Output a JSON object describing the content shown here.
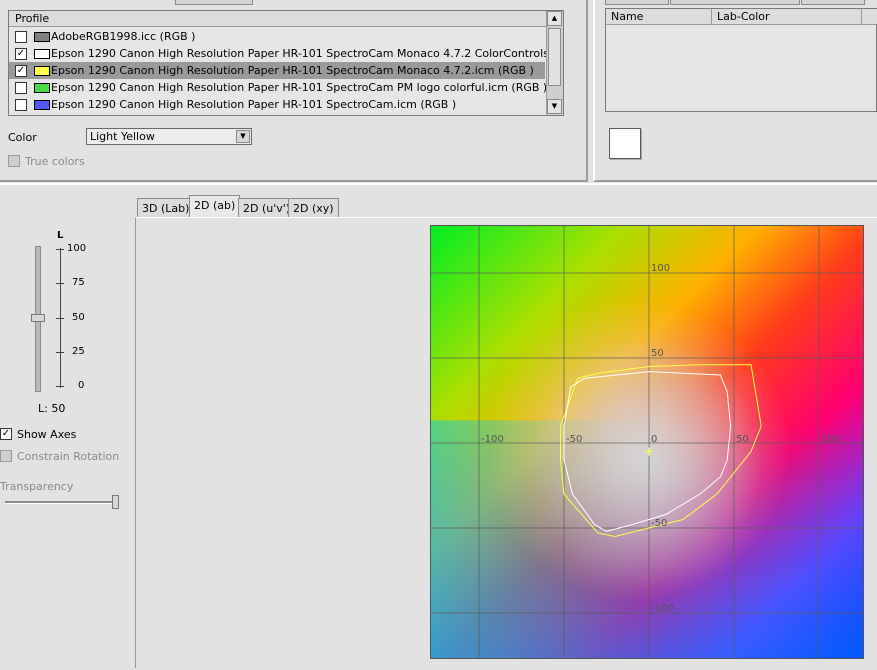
{
  "profiles_list": {
    "header": "Profile",
    "rows": [
      {
        "checked": false,
        "swatch": "#808080",
        "text": "AdobeRGB1998.icc (RGB )",
        "selected": false
      },
      {
        "checked": true,
        "swatch": "#ffffff",
        "text": "Epson 1290 Canon High Resolution Paper HR-101 SpectroCam Monaco 4.7.2 ColorControls.icm (RGB )",
        "selected": false
      },
      {
        "checked": true,
        "swatch": "#ffff44",
        "text": "Epson 1290 Canon High Resolution Paper HR-101 SpectroCam Monaco 4.7.2.icm (RGB )",
        "selected": true
      },
      {
        "checked": false,
        "swatch": "#44dd44",
        "text": "Epson 1290 Canon High Resolution Paper HR-101 SpectroCam PM logo colorful.icm (RGB )",
        "selected": false
      },
      {
        "checked": false,
        "swatch": "#5555ff",
        "text": "Epson 1290 Canon High Resolution Paper HR-101 SpectroCam.icm (RGB )",
        "selected": false
      }
    ]
  },
  "color_select": {
    "label": "Color",
    "value": "Light Yellow"
  },
  "true_colors": {
    "label": "True colors",
    "checked": false
  },
  "named_colors": {
    "col_name": "Name",
    "col_lab": "Lab-Color"
  },
  "tabs": [
    {
      "label": "3D (Lab)",
      "active": false
    },
    {
      "label": "2D (ab)",
      "active": true
    },
    {
      "label": "2D (u'v')",
      "active": false
    },
    {
      "label": "2D (xy)",
      "active": false
    }
  ],
  "l_slider": {
    "title": "L",
    "ticks": [
      "100",
      "75",
      "50",
      "25",
      "0"
    ],
    "value": 50,
    "readout": "L: 50"
  },
  "show_axes": {
    "label": "Show Axes",
    "checked": true
  },
  "constrain_rotation": {
    "label": "Constrain Rotation",
    "checked": false
  },
  "transparency": {
    "label": "Transparency",
    "value": 1.0
  },
  "ab_plot": {
    "a_labels": [
      "-100",
      "-50",
      "0",
      "50",
      "100"
    ],
    "b_labels": [
      "100",
      "50",
      "-50",
      "-100"
    ],
    "gamut_white": [
      [
        -46,
        33
      ],
      [
        -38,
        38
      ],
      [
        0,
        42
      ],
      [
        42,
        40
      ],
      [
        46,
        30
      ],
      [
        48,
        10
      ],
      [
        46,
        -10
      ],
      [
        42,
        -20
      ],
      [
        30,
        -30
      ],
      [
        10,
        -42
      ],
      [
        -10,
        -48
      ],
      [
        -25,
        -52
      ],
      [
        -32,
        -48
      ],
      [
        -45,
        -30
      ],
      [
        -50,
        -10
      ],
      [
        -50,
        10
      ],
      [
        -46,
        33
      ]
    ],
    "gamut_yellow": [
      [
        -42,
        38
      ],
      [
        -30,
        41
      ],
      [
        0,
        45
      ],
      [
        30,
        46
      ],
      [
        60,
        46
      ],
      [
        66,
        10
      ],
      [
        60,
        -5
      ],
      [
        40,
        -30
      ],
      [
        20,
        -45
      ],
      [
        0,
        -50
      ],
      [
        -20,
        -55
      ],
      [
        -30,
        -53
      ],
      [
        -50,
        -30
      ],
      [
        -52,
        -10
      ],
      [
        -52,
        10
      ],
      [
        -42,
        38
      ]
    ],
    "gamut_white_color": "#ffffff",
    "gamut_yellow_color": "#ffff44"
  }
}
